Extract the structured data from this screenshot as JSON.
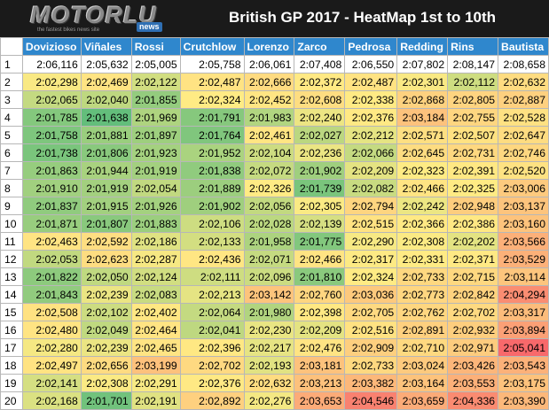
{
  "logo": {
    "name": "MOTORLU",
    "badge": "news",
    "tagline": "the fastest bikes news site"
  },
  "title": "British GP 2017 - HeatMap 1st to 10th",
  "colors": {
    "header_bg": "#1a1a1a",
    "column_header_bg": "#2f87cd",
    "heat_fast": "#63be7b",
    "heat_mid": "#ffeb84",
    "heat_slow": "#f8696b"
  },
  "chart_data": {
    "type": "heatmap",
    "title": "British GP 2017 - HeatMap 1st to 10th",
    "columns": [
      "Dovizioso",
      "Viñales",
      "Rossi",
      "Crutchlow",
      "Lorenzo",
      "Zarco",
      "Pedrosa",
      "Redding",
      "Rins",
      "Bautista"
    ],
    "row_labels": [
      "1",
      "2",
      "3",
      "4",
      "5",
      "6",
      "7",
      "8",
      "9",
      "10",
      "11",
      "12",
      "13",
      "14",
      "15",
      "16",
      "17",
      "18",
      "19",
      "20"
    ],
    "rows": [
      [
        "2:06,116",
        "2:05,632",
        "2:05,005",
        "2:05,758",
        "2:06,061",
        "2:07,408",
        "2:06,550",
        "2:07,802",
        "2:08,147",
        "2:08,658"
      ],
      [
        "2:02,298",
        "2:02,469",
        "2:02,122",
        "2:02,487",
        "2:02,666",
        "2:02,372",
        "2:02,487",
        "2:02,301",
        "2:02,112",
        "2:02,632"
      ],
      [
        "2:02,065",
        "2:02,040",
        "2:01,855",
        "2:02,324",
        "2:02,452",
        "2:02,608",
        "2:02,338",
        "2:02,868",
        "2:02,805",
        "2:02,887"
      ],
      [
        "2:01,785",
        "2:01,638",
        "2:01,969",
        "2:01,791",
        "2:01,983",
        "2:02,240",
        "2:02,376",
        "2:03,184",
        "2:02,755",
        "2:02,528"
      ],
      [
        "2:01,758",
        "2:01,881",
        "2:01,897",
        "2:01,764",
        "2:02,461",
        "2:02,027",
        "2:02,212",
        "2:02,571",
        "2:02,507",
        "2:02,647"
      ],
      [
        "2:01,738",
        "2:01,806",
        "2:01,923",
        "2:01,952",
        "2:02,104",
        "2:02,236",
        "2:02,066",
        "2:02,645",
        "2:02,731",
        "2:02,746"
      ],
      [
        "2:01,863",
        "2:01,944",
        "2:01,919",
        "2:01,838",
        "2:02,072",
        "2:01,902",
        "2:02,209",
        "2:02,323",
        "2:02,391",
        "2:02,520"
      ],
      [
        "2:01,910",
        "2:01,919",
        "2:02,054",
        "2:01,889",
        "2:02,326",
        "2:01,739",
        "2:02,082",
        "2:02,466",
        "2:02,325",
        "2:03,006"
      ],
      [
        "2:01,837",
        "2:01,915",
        "2:01,926",
        "2:01,902",
        "2:02,056",
        "2:02,305",
        "2:02,794",
        "2:02,242",
        "2:02,948",
        "2:03,137"
      ],
      [
        "2:01,871",
        "2:01,807",
        "2:01,883",
        "2:02,106",
        "2:02,028",
        "2:02,139",
        "2:02,515",
        "2:02,366",
        "2:02,386",
        "2:03,160"
      ],
      [
        "2:02,463",
        "2:02,592",
        "2:02,186",
        "2:02,133",
        "2:01,958",
        "2:01,775",
        "2:02,290",
        "2:02,308",
        "2:02,202",
        "2:03,566"
      ],
      [
        "2:02,053",
        "2:02,623",
        "2:02,287",
        "2:02,436",
        "2:02,071",
        "2:02,466",
        "2:02,317",
        "2:02,331",
        "2:02,371",
        "2:03,529"
      ],
      [
        "2:01,822",
        "2:02,050",
        "2:02,124",
        "2:02,111",
        "2:02,096",
        "2:01,810",
        "2:02,324",
        "2:02,733",
        "2:02,715",
        "2:03,114"
      ],
      [
        "2:01,843",
        "2:02,239",
        "2:02,083",
        "2:02,213",
        "2:03,142",
        "2:02,760",
        "2:03,036",
        "2:02,773",
        "2:02,842",
        "2:04,294"
      ],
      [
        "2:02,508",
        "2:02,102",
        "2:02,402",
        "2:02,064",
        "2:01,980",
        "2:02,398",
        "2:02,705",
        "2:02,762",
        "2:02,702",
        "2:03,317"
      ],
      [
        "2:02,480",
        "2:02,049",
        "2:02,464",
        "2:02,041",
        "2:02,230",
        "2:02,209",
        "2:02,516",
        "2:02,891",
        "2:02,932",
        "2:03,894"
      ],
      [
        "2:02,280",
        "2:02,239",
        "2:02,465",
        "2:02,396",
        "2:02,217",
        "2:02,476",
        "2:02,909",
        "2:02,710",
        "2:02,971",
        "2:05,041"
      ],
      [
        "2:02,497",
        "2:02,656",
        "2:03,199",
        "2:02,702",
        "2:02,193",
        "2:03,181",
        "2:02,733",
        "2:03,024",
        "2:03,426",
        "2:03,543"
      ],
      [
        "2:02,141",
        "2:02,308",
        "2:02,291",
        "2:02,376",
        "2:02,632",
        "2:03,213",
        "2:03,382",
        "2:03,164",
        "2:03,553",
        "2:03,175"
      ],
      [
        "2:02,168",
        "2:01,701",
        "2:02,191",
        "2:02,892",
        "2:02,276",
        "2:03,653",
        "2:04,546",
        "2:03,659",
        "2:04,336",
        "2:03,390"
      ]
    ]
  }
}
